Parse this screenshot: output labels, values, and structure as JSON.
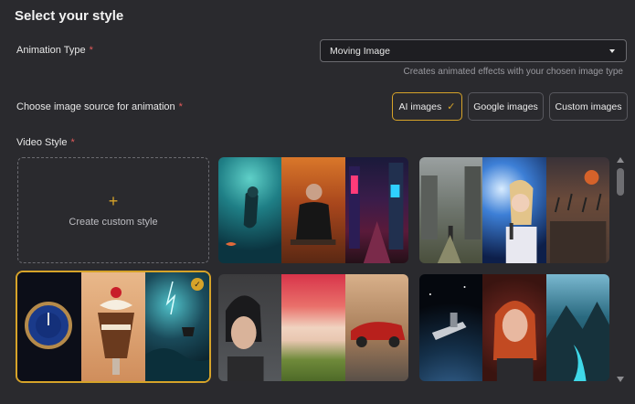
{
  "title": "Select your style",
  "animation": {
    "label": "Animation Type",
    "required_mark": "*",
    "selected": "Moving Image",
    "hint": "Creates animated effects with your chosen image type"
  },
  "source": {
    "label": "Choose image source for animation",
    "required_mark": "*",
    "options": [
      "AI images",
      "Google images",
      "Custom images"
    ],
    "selected": "AI images"
  },
  "video_style": {
    "label": "Video Style",
    "required_mark": "*",
    "create_custom": "Create custom style",
    "selected_index": 3,
    "tiles": [
      {
        "name": "style-tile-underwater-autumn-city",
        "panels": [
          "underwater-diver",
          "man-in-autumn-park",
          "neon-city-street"
        ]
      },
      {
        "name": "style-tile-ruins-singer-battle",
        "panels": [
          "ruined-city-walker",
          "singer-with-microphone",
          "medieval-battle"
        ]
      },
      {
        "name": "style-tile-watch-dessert-storm",
        "panels": [
          "luxury-watch",
          "ice-cream-sundae",
          "stormy-sea-ship"
        ]
      },
      {
        "name": "style-tile-portrait-landscape-car",
        "panels": [
          "woman-portrait",
          "pink-sky-landscape",
          "red-vintage-car"
        ]
      },
      {
        "name": "style-tile-space-portrait-valley",
        "panels": [
          "spaceship-earth-orbit",
          "redhead-portrait",
          "mountain-valley-river"
        ]
      }
    ]
  },
  "colors": {
    "accent": "#d6a329",
    "background": "#2a2a2e",
    "required": "#e25a5a"
  }
}
